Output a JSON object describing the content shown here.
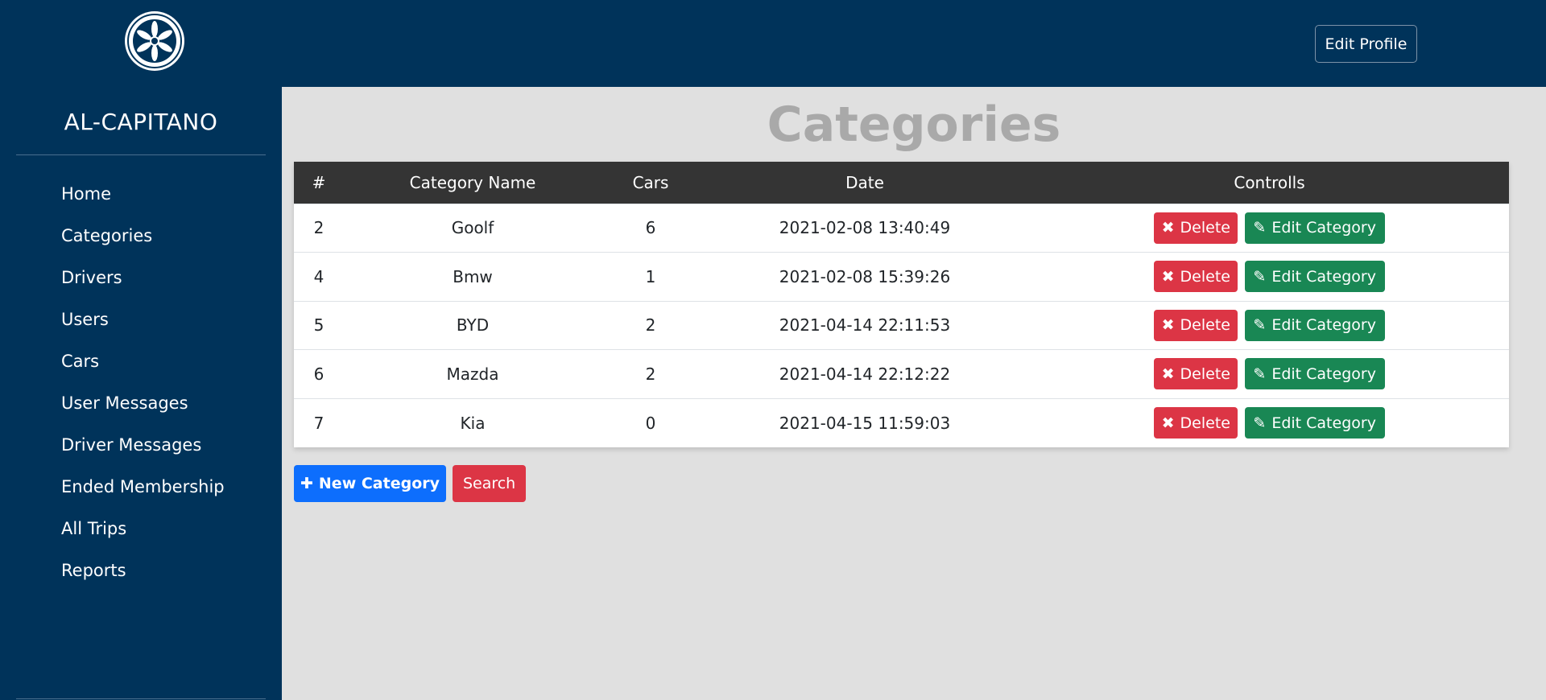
{
  "brand": {
    "name": "AL-CAPITANO",
    "logo_icon": "wheel-icon"
  },
  "header": {
    "edit_profile_label": "Edit Profile"
  },
  "sidebar": {
    "items": [
      {
        "label": "Home"
      },
      {
        "label": "Categories"
      },
      {
        "label": "Drivers"
      },
      {
        "label": "Users"
      },
      {
        "label": "Cars"
      },
      {
        "label": "User Messages"
      },
      {
        "label": "Driver Messages"
      },
      {
        "label": "Ended Membership"
      },
      {
        "label": "All Trips"
      },
      {
        "label": "Reports"
      }
    ]
  },
  "page": {
    "title": "Categories"
  },
  "table": {
    "headers": [
      "#",
      "Category Name",
      "Cars",
      "Date",
      "Controlls"
    ],
    "rows": [
      {
        "id": "2",
        "name": "Goolf",
        "cars": "6",
        "date": "2021-02-08 13:40:49"
      },
      {
        "id": "4",
        "name": "Bmw",
        "cars": "1",
        "date": "2021-02-08 15:39:26"
      },
      {
        "id": "5",
        "name": "BYD",
        "cars": "2",
        "date": "2021-04-14 22:11:53"
      },
      {
        "id": "6",
        "name": "Mazda",
        "cars": "2",
        "date": "2021-04-14 22:12:22"
      },
      {
        "id": "7",
        "name": "Kia",
        "cars": "0",
        "date": "2021-04-15 11:59:03"
      }
    ],
    "delete_label": "Delete",
    "edit_label": "Edit Category",
    "delete_icon": "times-icon",
    "edit_icon": "edit-icon"
  },
  "actions": {
    "new_category_label": "New Category",
    "search_label": "Search",
    "new_icon": "plus-icon"
  },
  "colors": {
    "sidebar_bg": "#00335a",
    "content_bg": "#e0e0e0",
    "table_header_bg": "#343434",
    "delete": "#dc3545",
    "edit": "#198754",
    "primary": "#0d6efd",
    "title": "#a9a9a9"
  }
}
